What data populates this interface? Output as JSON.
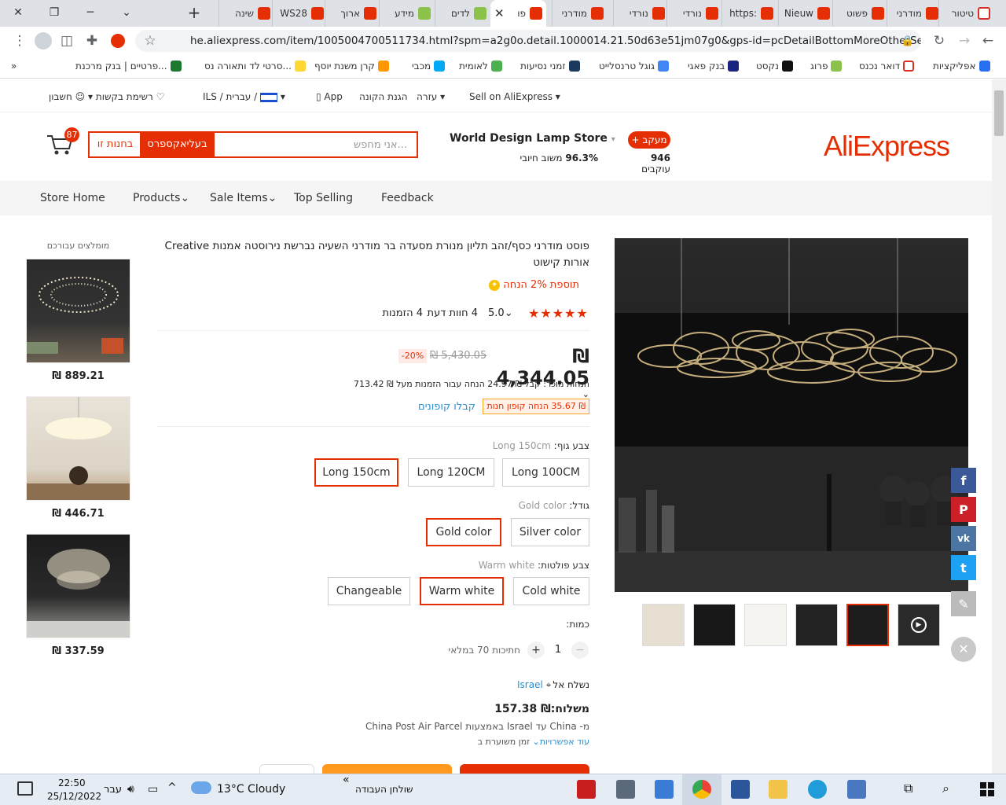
{
  "browser": {
    "tabs": [
      {
        "label": "טיטור",
        "icon": "gmail"
      },
      {
        "label": "מודרני",
        "icon": "aliexpress"
      },
      {
        "label": "פשוט",
        "icon": "aliexpress"
      },
      {
        "label": "Nieuw",
        "icon": "aliexpress"
      },
      {
        "label": "https:",
        "icon": "aliexpress"
      },
      {
        "label": "נורדי",
        "icon": "aliexpress"
      },
      {
        "label": "נורדי",
        "icon": "aliexpress"
      },
      {
        "label": "מודרני",
        "icon": "aliexpress"
      },
      {
        "label": "פו",
        "icon": "aliexpress",
        "active": true
      },
      {
        "label": "לדים",
        "icon": "green"
      },
      {
        "label": "מידע",
        "icon": "green"
      },
      {
        "label": "ארוך",
        "icon": "aliexpress"
      },
      {
        "label": "WS28",
        "icon": "aliexpress"
      },
      {
        "label": "שינה",
        "icon": "aliexpress"
      }
    ],
    "url": "he.aliexpress.com/item/1005004700511734.html?spm=a2g0o.detail.1000014.21.50d63e51jm07g0&gps-id=pcDetailBottomMoreOtherSeller&sc...",
    "bookmarks": [
      "אפליקציות",
      "דואר נכנס",
      "פרוג",
      "נקסט",
      "בנק פאגי",
      "גוגל טרנסלייט",
      "זמני נסיעות",
      "לאומית",
      "מכבי",
      "קרן משנת יוסף",
      "סרטי לד ותאורה נס...",
      "פרטיים | בנק מרכנת..."
    ],
    "bookmarks_more": "»"
  },
  "topbar": {
    "sell": "Sell on AliExpress",
    "help": "עזרה",
    "buyer_protection": "הגנת הקונה",
    "app": "App",
    "lang": "עברית /",
    "currency": "ILS",
    "wishlist": "רשימת בקשות",
    "account": "חשבון"
  },
  "header": {
    "logo": "AliExpress",
    "follow_btn": "+ מעקב",
    "followers": "946",
    "followers_label": "עוקבים",
    "store_name": "World Design Lamp Store",
    "rating": "96.3%",
    "rating_label": "משוב חיובי",
    "search_placeholder": "אני מחפש...",
    "search_ali": "בעליאקספרס",
    "search_store": "בחנות זו",
    "cart_count": "87"
  },
  "storenav": [
    "Store Home",
    "Products",
    "Sale Items",
    "Top Selling",
    "Feedback"
  ],
  "product": {
    "title": "פוסט מודרני כסף/זהב תליון מנורת מסעדה בר מודרני השעיה נברשת נירוסטה אמנות Creative אורות קישוט",
    "bonus": "תוספת 2% הנחה",
    "rating": "5.0",
    "reviews": "4 חוות דעת",
    "orders": "4 הזמנות",
    "price": "₪ 4,344.05",
    "old_price": "₪ 5,430.05",
    "discount": "-20%",
    "seller_discount": "הנחות מוכר: קבל ₪ 24.97 הנחה עבור הזמנות מעל ₪ 713.42",
    "coupon": "₪ 35.67 הנחה קופון חנות",
    "get_coupons": "קבלו קופונים",
    "body_color_label": "צבע גוף:",
    "body_color_value": "Long 150cm",
    "body_options": [
      "Long 100CM",
      "Long 120CM",
      "Long 150cm"
    ],
    "size_label": "גודל:",
    "size_value": "Gold color",
    "size_options": [
      "Silver color",
      "Gold color"
    ],
    "light_label": "צבע פולטות:",
    "light_value": "Warm white",
    "light_options": [
      "Cold white",
      "Warm white",
      "Changeable"
    ],
    "qty_label": "כמות:",
    "qty": "1",
    "qty_minus": "−",
    "qty_plus": "+",
    "stock": "חתיכות 70 במלאי",
    "ship_to_label": "נשלח אל",
    "ship_to": "Israel",
    "shipping": "משלוח:₪ 157.38",
    "shipping_via": "מ- China עד Israel באמצעות China Post Air Parcel",
    "more_options": "עוד אפשרויות",
    "estimated": "זמן משוערת ב"
  },
  "recommended": {
    "title": "מומלצים עבורכם",
    "prices": [
      "₪ 889.21",
      "₪ 446.71",
      "₪ 337.59"
    ]
  },
  "social": [
    "f",
    "P",
    "vk",
    "t",
    "✎"
  ],
  "taskbar": {
    "time": "22:50",
    "date": "25/12/2022",
    "lang": "עבר",
    "weather": "13°C  Cloudy",
    "desktop": "שולחן העבודה",
    "chevrons": "«"
  }
}
